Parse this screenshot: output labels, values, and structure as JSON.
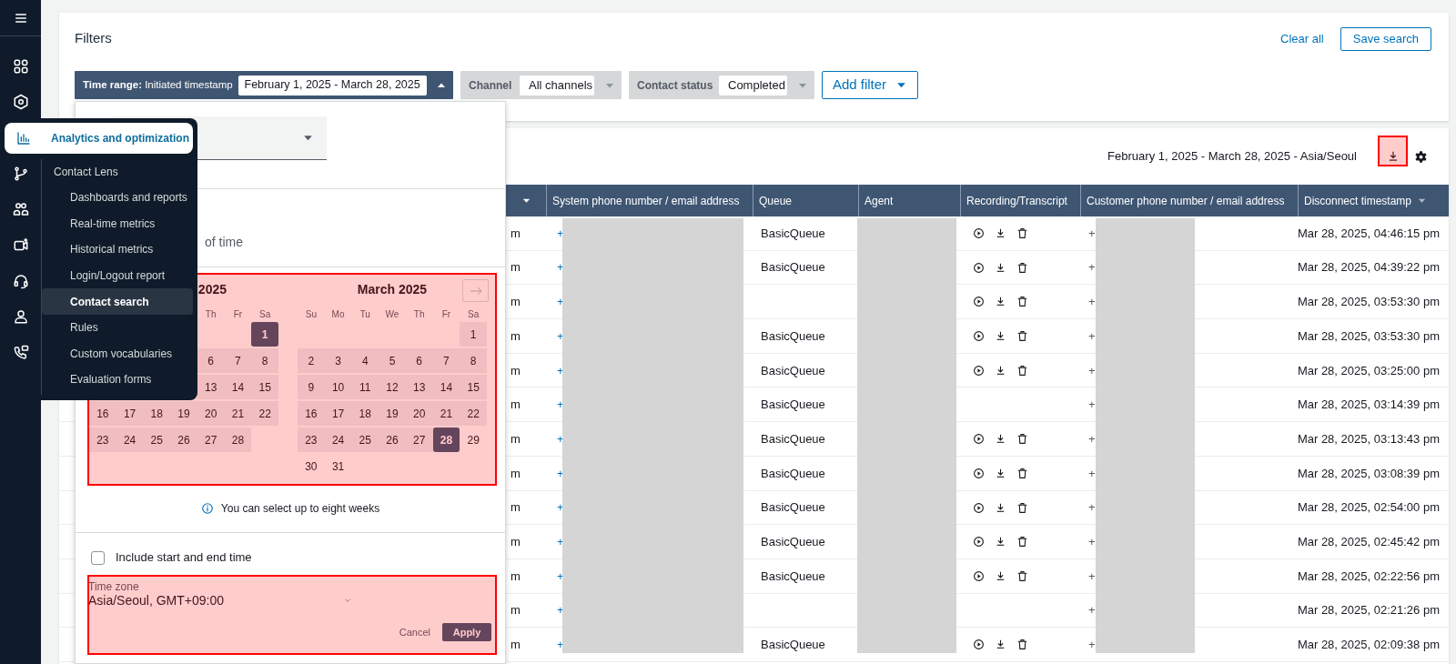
{
  "filters": {
    "title": "Filters",
    "clear_all": "Clear all",
    "save_search": "Save search",
    "chips": [
      {
        "kind": "time_range",
        "label": "**Time range:** Initiated timestamp",
        "value": "February 1, 2025 - March 28, 2025",
        "expanded": true
      },
      {
        "kind": "select",
        "label": "Channel",
        "value": "All channels",
        "expanded": false
      },
      {
        "kind": "select",
        "label": "Contact status",
        "value": "Completed",
        "expanded": false
      }
    ],
    "add_filter": "Add filter"
  },
  "results": {
    "range_label": "February 1, 2025 - March 28, 2025 - Asia/Seoul",
    "columns": [
      {
        "sorted": true
      },
      {
        "label": "System phone number / email address"
      },
      {
        "label": "Queue"
      },
      {
        "label": "Agent"
      },
      {
        "label": "Recording/Transcript"
      },
      {
        "label": "Customer phone number / email address"
      },
      {
        "label": "Disconnect timestamp",
        "sorted": false
      }
    ],
    "rows": [
      {
        "column_1": "m",
        "system_phone": "+",
        "queue": "BasicQueue",
        "recording": true,
        "customer_phone": "+",
        "disconnect_timestamp": "Mar 28, 2025, 04:46:15 pm"
      },
      {
        "column_1": "m",
        "system_phone": "+",
        "queue": "BasicQueue",
        "recording": true,
        "customer_phone": "+",
        "disconnect_timestamp": "Mar 28, 2025, 04:39:22 pm"
      },
      {
        "column_1": "m",
        "system_phone": "+",
        "recording": true,
        "customer_phone": "+",
        "disconnect_timestamp": "Mar 28, 2025, 03:53:30 pm"
      },
      {
        "column_1": "m",
        "system_phone": "+",
        "queue": "BasicQueue",
        "recording": true,
        "customer_phone": "+",
        "disconnect_timestamp": "Mar 28, 2025, 03:53:30 pm"
      },
      {
        "column_1": "m",
        "system_phone": "+",
        "queue": "BasicQueue",
        "recording": true,
        "customer_phone": "+",
        "disconnect_timestamp": "Mar 28, 2025, 03:25:00 pm"
      },
      {
        "column_1": "m",
        "system_phone": "+",
        "queue": "BasicQueue",
        "recording": false,
        "customer_phone": "+",
        "disconnect_timestamp": "Mar 28, 2025, 03:14:39 pm"
      },
      {
        "column_1": "m",
        "system_phone": "+",
        "queue": "BasicQueue",
        "recording": true,
        "customer_phone": "+",
        "disconnect_timestamp": "Mar 28, 2025, 03:13:43 pm"
      },
      {
        "column_1": "m",
        "system_phone": "+",
        "queue": "BasicQueue",
        "recording": true,
        "customer_phone": "+",
        "disconnect_timestamp": "Mar 28, 2025, 03:08:39 pm"
      },
      {
        "column_1": "m",
        "system_phone": "+",
        "queue": "BasicQueue",
        "recording": true,
        "customer_phone": "+",
        "disconnect_timestamp": "Mar 28, 2025, 02:54:00 pm"
      },
      {
        "column_1": "m",
        "system_phone": "+",
        "queue": "BasicQueue",
        "recording": true,
        "customer_phone": "+",
        "disconnect_timestamp": "Mar 28, 2025, 02:45:42 pm"
      },
      {
        "column_1": "m",
        "system_phone": "+",
        "queue": "BasicQueue",
        "recording": true,
        "customer_phone": "+",
        "disconnect_timestamp": "Mar 28, 2025, 02:22:56 pm"
      },
      {
        "column_1": "m",
        "system_phone": "+",
        "recording": false,
        "customer_phone": "+",
        "disconnect_timestamp": "Mar 28, 2025, 02:21:26 pm"
      },
      {
        "column_1": "m",
        "system_phone": "+",
        "queue": "BasicQueue",
        "recording": true,
        "customer_phone": "+",
        "disconnect_timestamp": "Mar 28, 2025, 02:09:38 pm"
      }
    ]
  },
  "date_picker": {
    "range_text": "of time",
    "months": [
      {
        "title": "2025",
        "day_names": [
          "Th",
          "Fr",
          "Sa"
        ],
        "weeks": [
          [
            {
              "day": "1",
              "selected": true,
              "in_range": true
            }
          ],
          [
            {
              "day": "6",
              "selected": false,
              "in_range": true
            },
            {
              "day": "7",
              "selected": false,
              "in_range": true
            },
            {
              "day": "8",
              "selected": false,
              "in_range": true
            }
          ],
          [
            {
              "day": "13",
              "selected": false,
              "in_range": true
            },
            {
              "day": "14",
              "selected": false,
              "in_range": true
            },
            {
              "day": "15",
              "selected": false,
              "in_range": true
            }
          ],
          [
            {
              "day": "16",
              "selected": false,
              "in_range": true
            },
            {
              "day": "17",
              "selected": false,
              "in_range": true
            },
            {
              "day": "18",
              "selected": false,
              "in_range": true
            },
            {
              "day": "19",
              "selected": false,
              "in_range": true
            },
            {
              "day": "20",
              "selected": false,
              "in_range": true
            },
            {
              "day": "21",
              "selected": false,
              "in_range": true
            },
            {
              "day": "22",
              "selected": false,
              "in_range": true
            }
          ],
          [
            {
              "day": "23",
              "selected": false,
              "in_range": true
            },
            {
              "day": "24",
              "selected": false,
              "in_range": true
            },
            {
              "day": "25",
              "selected": false,
              "in_range": true
            },
            {
              "day": "26",
              "selected": false,
              "in_range": true
            },
            {
              "day": "27",
              "selected": false,
              "in_range": true
            },
            {
              "day": "28",
              "selected": false,
              "in_range": true
            }
          ]
        ]
      },
      {
        "title": "March 2025",
        "day_names": [
          "Su",
          "Mo",
          "Tu",
          "We",
          "Th",
          "Fr",
          "Sa"
        ],
        "weeks": [
          [
            {
              "day": "1",
              "selected": false,
              "in_range": true
            }
          ],
          [
            {
              "day": "2",
              "selected": false,
              "in_range": true
            },
            {
              "day": "3",
              "selected": false,
              "in_range": true
            },
            {
              "day": "4",
              "selected": false,
              "in_range": true
            },
            {
              "day": "5",
              "selected": false,
              "in_range": true
            },
            {
              "day": "6",
              "selected": false,
              "in_range": true
            },
            {
              "day": "7",
              "selected": false,
              "in_range": true
            },
            {
              "day": "8",
              "selected": false,
              "in_range": true
            }
          ],
          [
            {
              "day": "9",
              "selected": false,
              "in_range": true
            },
            {
              "day": "10",
              "selected": false,
              "in_range": true
            },
            {
              "day": "11",
              "selected": false,
              "in_range": true
            },
            {
              "day": "12",
              "selected": false,
              "in_range": true
            },
            {
              "day": "13",
              "selected": false,
              "in_range": true
            },
            {
              "day": "14",
              "selected": false,
              "in_range": true
            },
            {
              "day": "15",
              "selected": false,
              "in_range": true
            }
          ],
          [
            {
              "day": "16",
              "selected": false,
              "in_range": true
            },
            {
              "day": "17",
              "selected": false,
              "in_range": true
            },
            {
              "day": "18",
              "selected": false,
              "in_range": true
            },
            {
              "day": "19",
              "selected": false,
              "in_range": true
            },
            {
              "day": "20",
              "selected": false,
              "in_range": true
            },
            {
              "day": "21",
              "selected": false,
              "in_range": true
            },
            {
              "day": "22",
              "selected": false,
              "in_range": true
            }
          ],
          [
            {
              "day": "23",
              "selected": false,
              "in_range": true
            },
            {
              "day": "24",
              "selected": false,
              "in_range": true
            },
            {
              "day": "25",
              "selected": false,
              "in_range": true
            },
            {
              "day": "26",
              "selected": false,
              "in_range": true
            },
            {
              "day": "27",
              "selected": false,
              "in_range": true
            },
            {
              "day": "28",
              "selected": true,
              "in_range": true
            },
            {
              "day": "29",
              "selected": false,
              "in_range": false
            }
          ],
          [
            {
              "day": "30",
              "selected": false,
              "in_range": false
            },
            {
              "day": "31",
              "selected": false,
              "in_range": false
            }
          ]
        ]
      }
    ],
    "hint": "You can select up to eight weeks",
    "include_time": {
      "label": "Include start and end time",
      "checked": false
    },
    "time_zone": {
      "label": "Time zone",
      "value": "Asia/Seoul, GMT+09:00"
    },
    "cancel": "Cancel",
    "apply": "Apply"
  },
  "nav_flyout": {
    "title": "Analytics and optimization",
    "section": "Contact Lens",
    "items": [
      {
        "label": "Dashboards and reports",
        "selected": false
      },
      {
        "label": "Real-time metrics",
        "selected": false
      },
      {
        "label": "Historical metrics",
        "selected": false
      },
      {
        "label": "Login/Logout report",
        "selected": false
      },
      {
        "label": "Contact search",
        "selected": true
      },
      {
        "label": "Rules",
        "selected": false
      },
      {
        "label": "Custom vocabularies",
        "selected": false
      },
      {
        "label": "Evaluation forms",
        "selected": false
      }
    ]
  }
}
